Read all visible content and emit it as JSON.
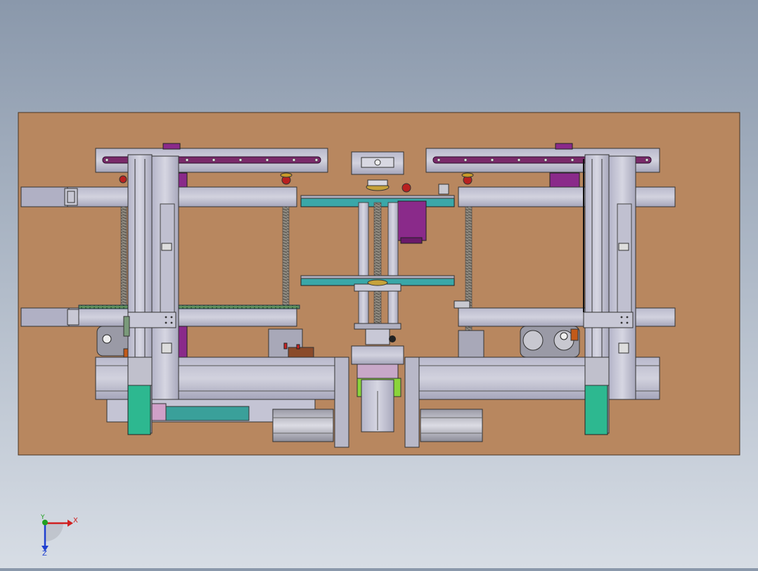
{
  "scene": {
    "background_top": "#8a98ab",
    "background_bottom": "#d7dde5",
    "plate_color": "#b8875f"
  },
  "triad": {
    "x_label": "X",
    "y_label": "Y",
    "z_label": "Z",
    "x_color": "#d02020",
    "y_color": "#20a020",
    "z_color": "#2040d0"
  }
}
